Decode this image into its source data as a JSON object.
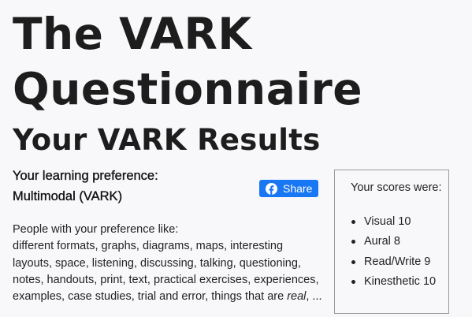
{
  "header": {
    "title_line1": "The VARK",
    "title_line2": "Questionnaire",
    "subtitle": "Your VARK Results"
  },
  "preference": {
    "label": "Your learning preference:",
    "value": "Multimodal (VARK)"
  },
  "share": {
    "label": "Share",
    "icon": "facebook-icon",
    "color": "#1877f2"
  },
  "description": {
    "intro": "People with your preference like:",
    "body": "different formats, graphs, diagrams, maps, interesting layouts, space, listening, discussing, talking, questioning, notes, handouts, print, text, practical exercises, experiences, examples, case studies, trial and error, things that are ",
    "italic": "real",
    "ending": ", ..."
  },
  "scores": {
    "title": "Your scores were:",
    "items": [
      {
        "label": "Visual 10"
      },
      {
        "label": "Aural 8"
      },
      {
        "label": "Read/Write 9"
      },
      {
        "label": "Kinesthetic 10"
      }
    ]
  }
}
